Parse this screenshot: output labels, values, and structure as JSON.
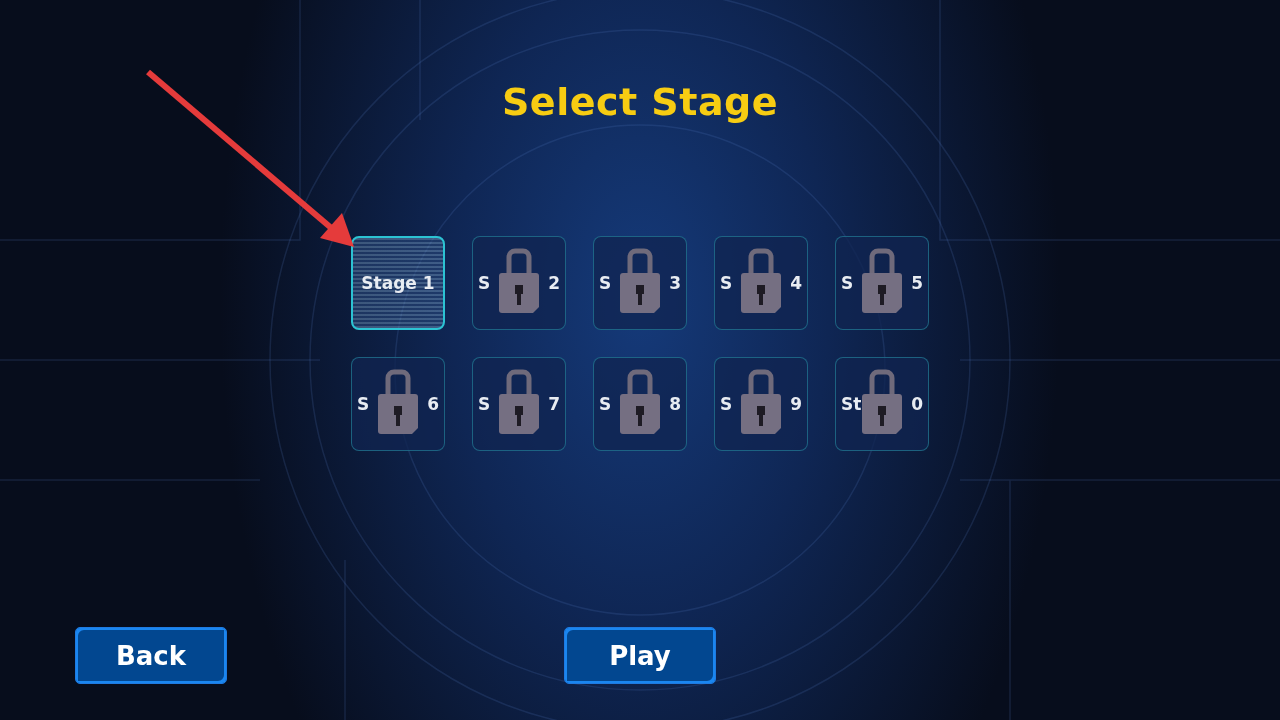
{
  "title": "Select Stage",
  "stages": [
    {
      "locked": false,
      "selected": true,
      "label": "Stage 1"
    },
    {
      "locked": true,
      "selected": false,
      "label_start": "S",
      "label_end": "2"
    },
    {
      "locked": true,
      "selected": false,
      "label_start": "S",
      "label_end": "3"
    },
    {
      "locked": true,
      "selected": false,
      "label_start": "S",
      "label_end": "4"
    },
    {
      "locked": true,
      "selected": false,
      "label_start": "S",
      "label_end": "5"
    },
    {
      "locked": true,
      "selected": false,
      "label_start": "S",
      "label_end": "6"
    },
    {
      "locked": true,
      "selected": false,
      "label_start": "S",
      "label_end": "7"
    },
    {
      "locked": true,
      "selected": false,
      "label_start": "S",
      "label_end": "8"
    },
    {
      "locked": true,
      "selected": false,
      "label_start": "S",
      "label_end": "9"
    },
    {
      "locked": true,
      "selected": false,
      "label_start": "St",
      "label_end": "0"
    }
  ],
  "buttons": [
    {
      "label": "Back"
    },
    {
      "label": "Play"
    }
  ]
}
